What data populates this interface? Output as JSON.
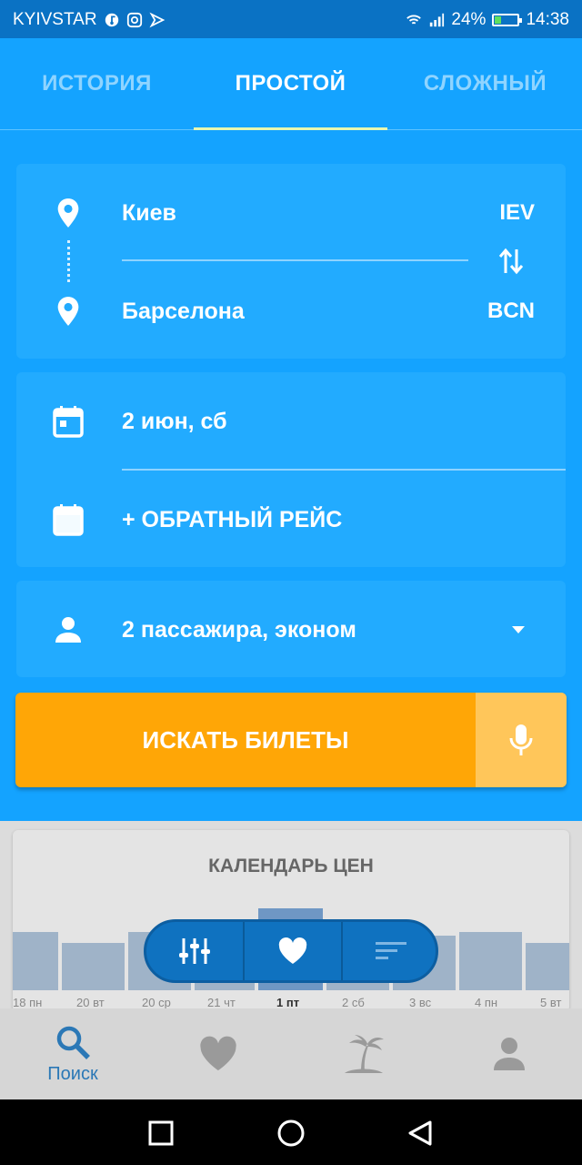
{
  "status_bar": {
    "carrier": "KYIVSTAR",
    "battery": "24%",
    "time": "14:38"
  },
  "tabs": [
    {
      "label": "ИСТОРИЯ",
      "active": false
    },
    {
      "label": "ПРОСТОЙ",
      "active": true
    },
    {
      "label": "СЛОЖНЫЙ",
      "active": false
    }
  ],
  "route": {
    "origin": {
      "city": "Киев",
      "code": "IEV"
    },
    "destination": {
      "city": "Барселона",
      "code": "BCN"
    }
  },
  "dates": {
    "depart": "2 июн, сб",
    "return_label": "+ ОБРАТНЫЙ РЕЙС"
  },
  "passengers": {
    "label": "2 пассажира, эконом"
  },
  "search_button": {
    "label": "ИСКАТЬ БИЛЕТЫ"
  },
  "price_calendar": {
    "title": "КАЛЕНДАРЬ ЦЕН",
    "day_labels": [
      "18 пн",
      "20 вт",
      "20 ср",
      "21 чт",
      "1 пт",
      "2 сб",
      "3 вс",
      "4 пн",
      "5 вт"
    ]
  },
  "bottom_nav": [
    {
      "label": "Поиск",
      "icon": "search-icon",
      "active": true
    },
    {
      "label": "",
      "icon": "heart-icon",
      "active": false
    },
    {
      "label": "",
      "icon": "palm-icon",
      "active": false
    },
    {
      "label": "",
      "icon": "profile-icon",
      "active": false
    }
  ],
  "colors": {
    "primary": "#14a3ff",
    "accent": "#ffa606",
    "dark_blue": "#0f72c0"
  }
}
